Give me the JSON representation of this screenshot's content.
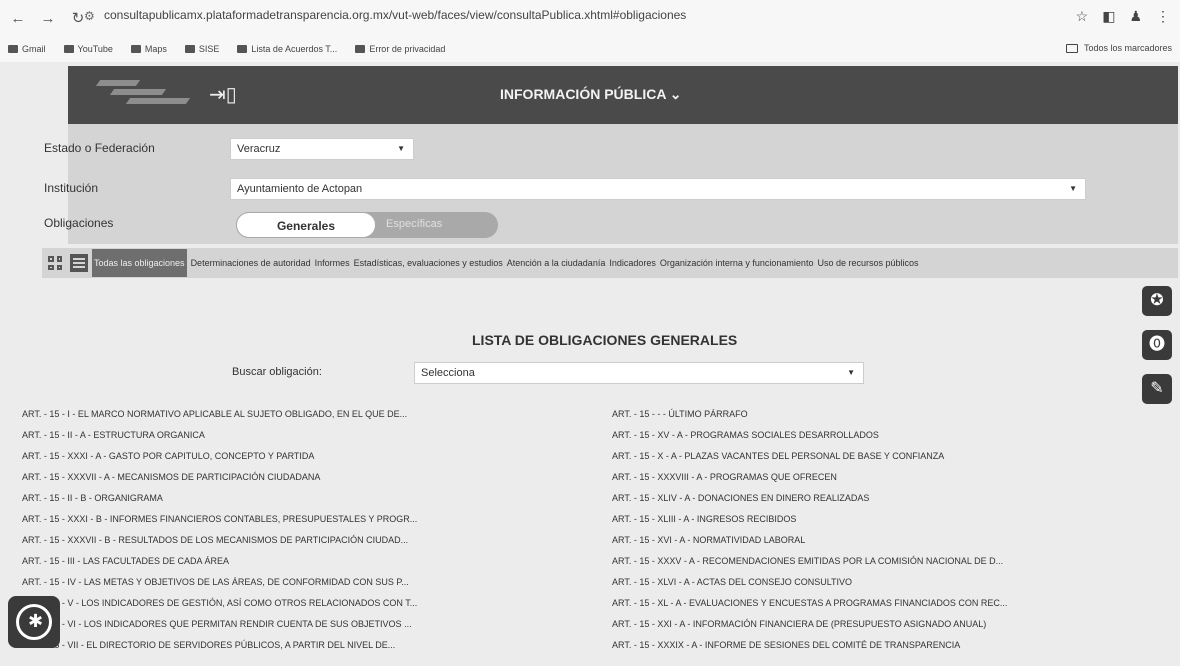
{
  "browser": {
    "url": "consultapublicamx.plataformadetransparencia.org.mx/vut-web/faces/view/consultaPublica.xhtml#obligaciones",
    "bookmarks": [
      "Gmail",
      "YouTube",
      "Maps",
      "SISE",
      "Lista de Acuerdos T...",
      "Error de privacidad"
    ],
    "all_bookmarks": "Todos los marcadores"
  },
  "header": {
    "title": "INFORMACIÓN PÚBLICA ⌄"
  },
  "form": {
    "estado_label": "Estado o Federación",
    "estado_value": "Veracruz",
    "institucion_label": "Institución",
    "institucion_value": "Ayuntamiento de Actopan",
    "obligaciones_label": "Obligaciones",
    "toggle_on": "Generales",
    "toggle_off": "Específicas"
  },
  "filters": {
    "active": "Todas las obligaciones",
    "tabs": [
      "Determinaciones de autoridad",
      "Informes",
      "Estadísticas, evaluaciones y estudios",
      "Atención a la ciudadanía",
      "Indicadores",
      "Organización interna y funcionamiento",
      "Uso de recursos públicos"
    ]
  },
  "list": {
    "title": "LISTA DE OBLIGACIONES GENERALES",
    "search_label": "Buscar obligación:",
    "search_value": "Selecciona",
    "left": [
      "ART. - 15 - I - EL MARCO NORMATIVO APLICABLE AL SUJETO OBLIGADO, EN EL QUE DE...",
      "ART. - 15 - II - A - ESTRUCTURA ORGANICA",
      "ART. - 15 - XXXI - A - GASTO POR CAPITULO, CONCEPTO Y PARTIDA",
      "ART. - 15 - XXXVII - A - MECANISMOS DE PARTICIPACIÓN CIUDADANA",
      "ART. - 15 - II - B - ORGANIGRAMA",
      "ART. - 15 - XXXI - B - INFORMES FINANCIEROS CONTABLES, PRESUPUESTALES Y PROGR...",
      "ART. - 15 - XXXVII - B - RESULTADOS DE LOS MECANISMOS DE PARTICIPACIÓN CIUDAD...",
      "ART. - 15 - III - LAS FACULTADES DE CADA ÁREA",
      "ART. - 15 - IV - LAS METAS Y OBJETIVOS DE LAS ÁREAS, DE CONFORMIDAD CON SUS P...",
      "ART. - 15 - V - LOS INDICADORES DE GESTIÓN, ASÍ COMO OTROS RELACIONADOS CON T...",
      "ART. - 15 - VI - LOS INDICADORES QUE PERMITAN RENDIR CUENTA DE SUS OBJETIVOS ...",
      "ART. - 15 - VII - EL DIRECTORIO DE SERVIDORES PÚBLICOS, A PARTIR DEL NIVEL DE..."
    ],
    "right": [
      "ART. - 15 - - - ÚLTIMO PÁRRAFO",
      "ART. - 15 - XV - A - PROGRAMAS SOCIALES DESARROLLADOS",
      "ART. - 15 - X - A - PLAZAS VACANTES DEL PERSONAL DE BASE Y CONFIANZA",
      "ART. - 15 - XXXVIII - A - PROGRAMAS QUE OFRECEN",
      "ART. - 15 - XLIV - A - DONACIONES EN DINERO REALIZADAS",
      "ART. - 15 - XLIII - A - INGRESOS RECIBIDOS",
      "ART. - 15 - XVI - A - NORMATIVIDAD LABORAL",
      "ART. - 15 - XXXV - A - RECOMENDACIONES EMITIDAS POR LA COMISIÓN NACIONAL DE D...",
      "ART. - 15 - XLVI - A - ACTAS DEL CONSEJO CONSULTIVO",
      "ART. - 15 - XL - A - EVALUACIONES Y ENCUESTAS A PROGRAMAS FINANCIADOS CON REC...",
      "ART. - 15 - XXI - A - INFORMACIÓN FINANCIERA DE (PRESUPUESTO ASIGNADO ANUAL)",
      "ART. - 15 - XXXIX - A - INFORME DE SESIONES DEL COMITÉ DE TRANSPARENCIA"
    ]
  }
}
